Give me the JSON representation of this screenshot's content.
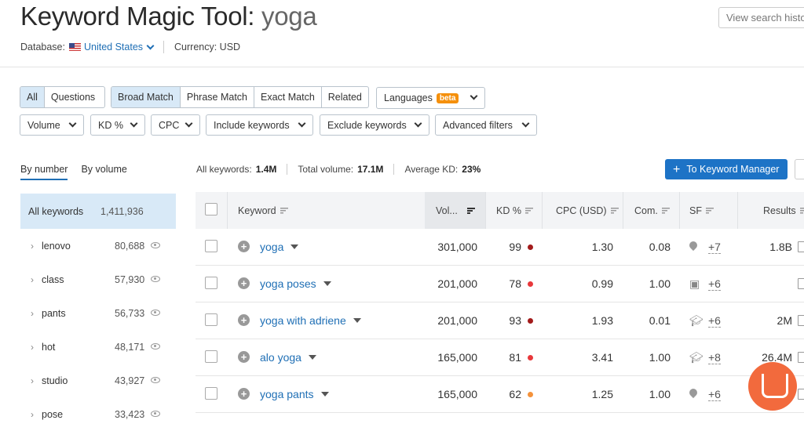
{
  "header": {
    "title_prefix": "Keyword Magic Tool:",
    "title_query": "yoga",
    "history_button": "View search history",
    "database_label": "Database:",
    "database_value": "United States",
    "currency_label": "Currency: USD"
  },
  "filters": {
    "seg1": [
      "All",
      "Questions"
    ],
    "match": [
      "Broad Match",
      "Phrase Match",
      "Exact Match",
      "Related"
    ],
    "languages": "Languages",
    "beta": "beta",
    "dropdowns": [
      "Volume",
      "KD %",
      "CPC",
      "Include keywords",
      "Exclude keywords",
      "Advanced filters"
    ]
  },
  "sidebar": {
    "tabs": [
      "By number",
      "By volume"
    ],
    "all_label": "All keywords",
    "all_count": "1,411,936",
    "items": [
      {
        "label": "lenovo",
        "count": "80,688"
      },
      {
        "label": "class",
        "count": "57,930"
      },
      {
        "label": "pants",
        "count": "56,733"
      },
      {
        "label": "hot",
        "count": "48,171"
      },
      {
        "label": "studio",
        "count": "43,927"
      },
      {
        "label": "pose",
        "count": "33,423"
      }
    ]
  },
  "summary": {
    "all_keywords_label": "All keywords:",
    "all_keywords_value": "1.4M",
    "total_volume_label": "Total volume:",
    "total_volume_value": "17.1M",
    "avg_kd_label": "Average KD:",
    "avg_kd_value": "23%",
    "km_button": "To Keyword Manager"
  },
  "table": {
    "headers": {
      "keyword": "Keyword",
      "volume": "Vol...",
      "kd": "KD %",
      "cpc": "CPC (USD)",
      "com": "Com.",
      "sf": "SF",
      "results": "Results"
    },
    "rows": [
      {
        "keyword": "yoga",
        "volume": "301,000",
        "kd": "99",
        "kd_color": "#a31b1b",
        "cpc": "1.30",
        "com": "0.08",
        "sf_icon": "map-pin-icon",
        "sf": "+7",
        "results": "1.8B"
      },
      {
        "keyword": "yoga poses",
        "volume": "201,000",
        "kd": "78",
        "kd_color": "#e8383b",
        "cpc": "0.99",
        "com": "1.00",
        "sf_icon": "image-pack-icon",
        "sf": "+6",
        "results": ""
      },
      {
        "keyword": "yoga with adriene",
        "volume": "201,000",
        "kd": "93",
        "kd_color": "#a31b1b",
        "cpc": "1.93",
        "com": "0.01",
        "sf_icon": "graduation-cap-icon",
        "sf": "+6",
        "results": "2M"
      },
      {
        "keyword": "alo yoga",
        "volume": "165,000",
        "kd": "81",
        "kd_color": "#e8383b",
        "cpc": "3.41",
        "com": "1.00",
        "sf_icon": "graduation-cap-icon",
        "sf": "+8",
        "results": "26.4M"
      },
      {
        "keyword": "yoga pants",
        "volume": "165,000",
        "kd": "62",
        "kd_color": "#f4923b",
        "cpc": "1.25",
        "com": "1.00",
        "sf_icon": "map-pin-icon",
        "sf": "+6",
        "results": ""
      }
    ]
  },
  "colors": {
    "accent": "#1d73c6",
    "chat": "#f26a3d"
  }
}
